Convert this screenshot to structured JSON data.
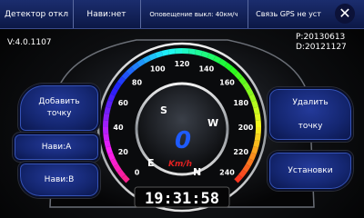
{
  "topbar": {
    "detector": "Детектор откл",
    "navi": "Нави:нет",
    "alert": "Оповещение выкл: 40км/ч",
    "gps": "Связь GPS не уст"
  },
  "info": {
    "version": "V:4.0.1107",
    "p_date": "P:20130613",
    "d_date": "D:20121127"
  },
  "buttons": {
    "add_line1": "Добавить",
    "add_line2": "точку",
    "navi_a": "Нави:A",
    "navi_b": "Нави:B",
    "delete_line1": "Удалить",
    "delete_line2": "точку",
    "settings": "Установки"
  },
  "speedometer": {
    "ticks": [
      "0",
      "20",
      "40",
      "60",
      "80",
      "100",
      "120",
      "140",
      "160",
      "180",
      "200",
      "220",
      "240"
    ],
    "speed": "0",
    "unit": "Km/h",
    "compass": {
      "n": "S",
      "w": "W",
      "e": "E",
      "s": "N"
    },
    "clock": "19:31:58"
  },
  "colors": {
    "topbar": "#0c1846",
    "button": "#1a2f80",
    "speed_digit": "#1e5bff",
    "unit": "#e02020"
  }
}
